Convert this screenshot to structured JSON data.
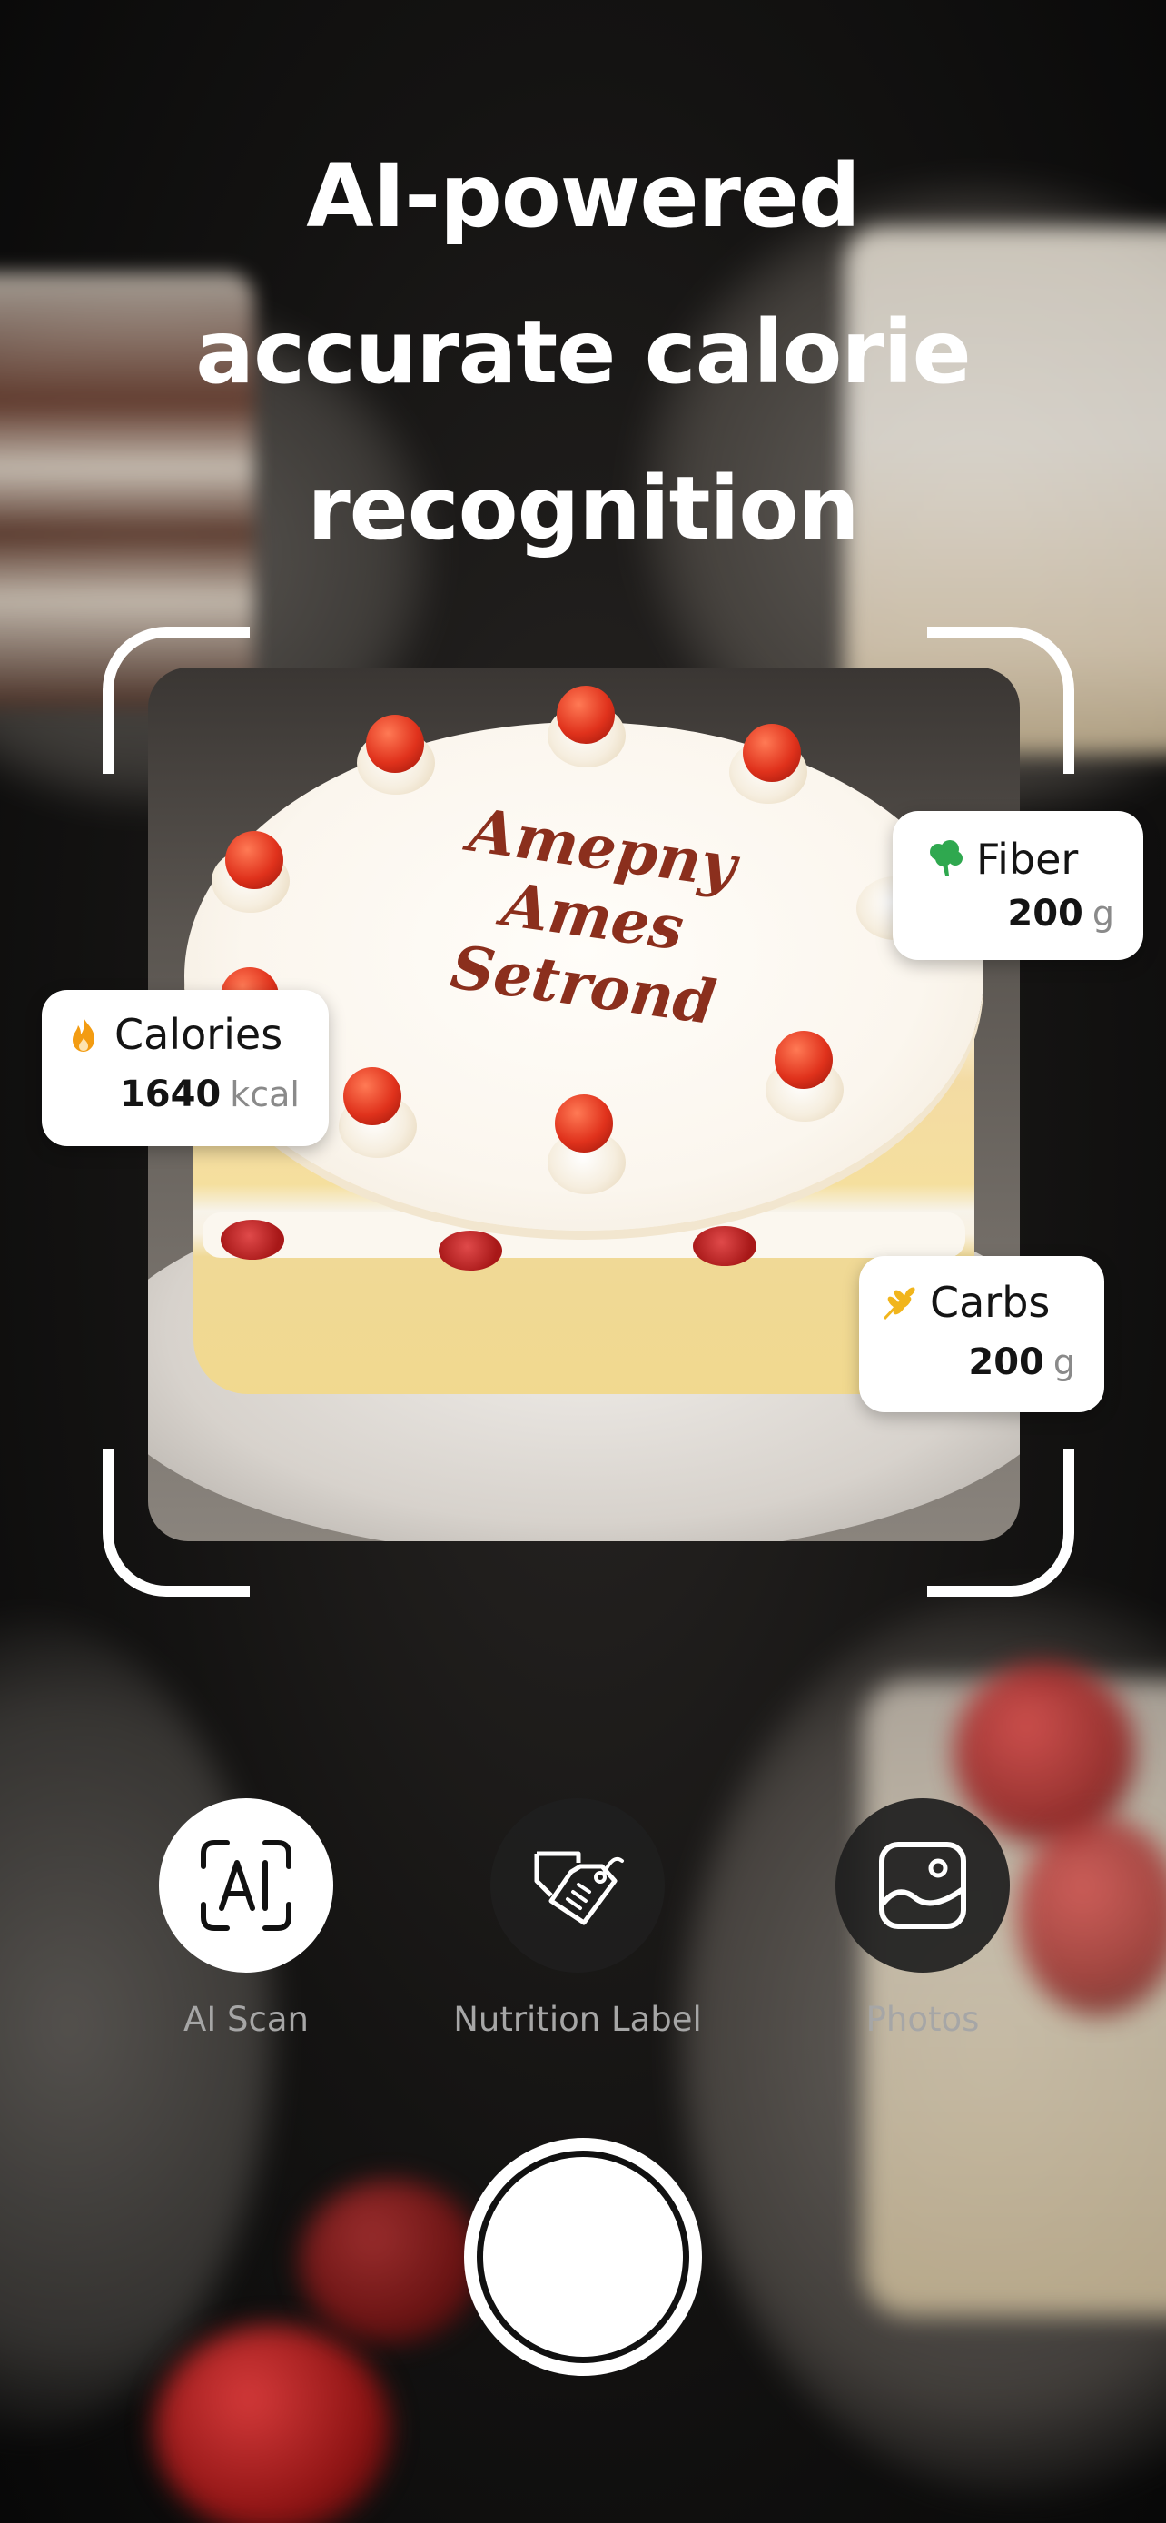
{
  "headline": "AI-powered\naccurate calorie\nrecognition",
  "cake_writing": "Amepny\nAmes\nSetrond",
  "badges": {
    "fiber": {
      "label": "Fiber",
      "value": "200",
      "unit": "g",
      "icon": "broccoli-icon",
      "icon_color": "#2fa84f"
    },
    "calories": {
      "label": "Calories",
      "value": "1640",
      "unit": "kcal",
      "icon": "flame-icon",
      "icon_color": "#f39c12"
    },
    "carbs": {
      "label": "Carbs",
      "value": "200",
      "unit": "g",
      "icon": "wheat-icon",
      "icon_color": "#f1b51c"
    }
  },
  "actions": [
    {
      "label": "AI Scan",
      "icon": "ai-scan-icon",
      "selected": true
    },
    {
      "label": "Nutrition Label",
      "icon": "price-tag-icon",
      "selected": false
    },
    {
      "label": "Photos",
      "icon": "image-icon",
      "selected": false
    }
  ],
  "shutter": {
    "icon": "shutter-button"
  }
}
